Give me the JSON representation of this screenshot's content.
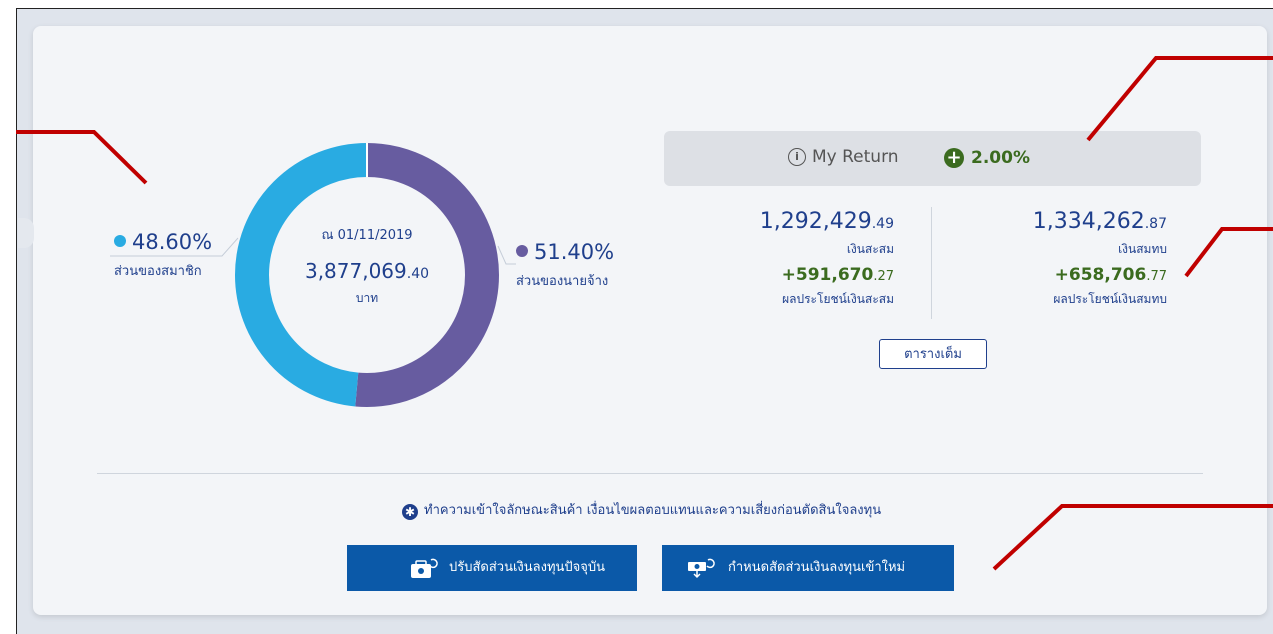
{
  "donut": {
    "date_label": "ณ 01/11/2019",
    "total_integer": "3,877,069",
    "total_decimal": ".40",
    "unit": "บาท",
    "member_share_fraction": 0.486,
    "employer_share_fraction": 0.514
  },
  "member": {
    "percent": "48.60%",
    "label": "ส่วนของสมาชิก",
    "color": "#29abe2"
  },
  "employer": {
    "percent": "51.40%",
    "label": "ส่วนของนายจ้าง",
    "color": "#675ca0"
  },
  "my_return": {
    "label": "My Return",
    "value": "2.00%"
  },
  "savings": {
    "value_integer": "1,292,429",
    "value_decimal": ".49",
    "label": "เงินสะสม",
    "gain_integer": "+591,670",
    "gain_decimal": ".27",
    "gain_label": "ผลประโยชน์เงินสะสม"
  },
  "contribution": {
    "value_integer": "1,334,262",
    "value_decimal": ".87",
    "label": "เงินสมทบ",
    "gain_integer": "+658,706",
    "gain_decimal": ".77",
    "gain_label": "ผลประโยชน์เงินสมทบ"
  },
  "full_table_button": "ตารางเต็ม",
  "disclaimer": "ทำความเข้าใจลักษณะสินค้า เงื่อนไขผลตอบแทนและความเสี่ยงก่อนตัดสินใจลงทุน",
  "actions": {
    "adjust_current": "ปรับสัดส่วนเงินลงทุนปัจจุบัน",
    "set_new": "กำหนดสัดส่วนเงินลงทุนเข้าใหม่"
  },
  "colors": {
    "primary_text": "#1f3f8c",
    "gain_green": "#3b6b1f",
    "button_blue": "#0b59a8",
    "annotation_red": "#c00000"
  },
  "icons": {
    "info": "info-circle-icon",
    "plus": "plus-circle-icon",
    "asterisk": "asterisk-icon",
    "adjust": "wallet-refresh-icon",
    "set_new": "hand-money-icon"
  }
}
